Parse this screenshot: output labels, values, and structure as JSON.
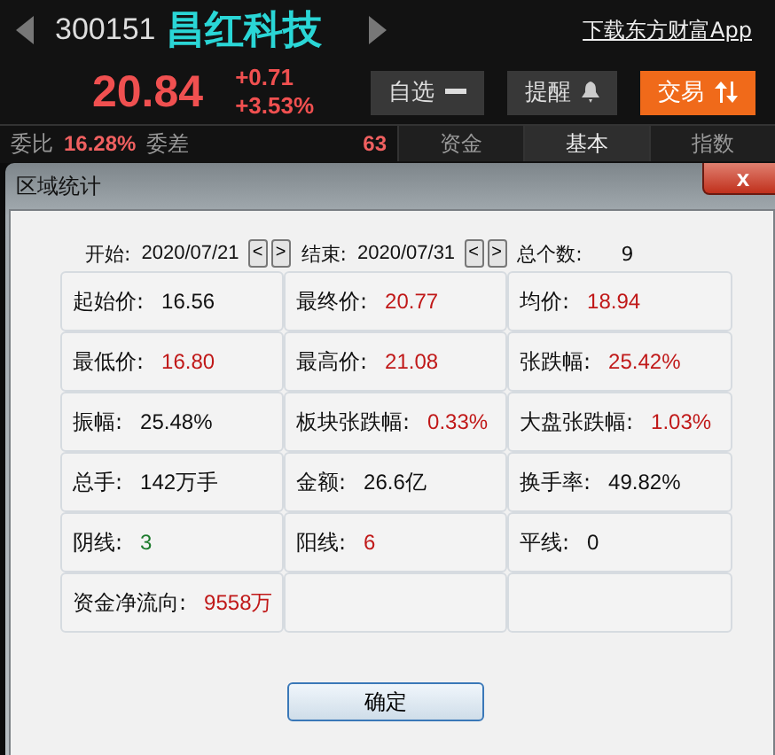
{
  "quote": {
    "code": "300151",
    "name": "昌红科技",
    "price": "20.84",
    "change": "+0.71",
    "change_pct": "+3.53%",
    "download_link": "下载东方财富App"
  },
  "actions": [
    {
      "label": "自选",
      "kind": "minus"
    },
    {
      "label": "提醒",
      "kind": "bell"
    },
    {
      "label": "交易",
      "kind": "trade"
    }
  ],
  "bid_ratio": {
    "label": "委比",
    "value": "16.28%",
    "diff_label": "委差",
    "diff_value": "63"
  },
  "tabs": [
    {
      "label": "资金",
      "selected": false
    },
    {
      "label": "基本",
      "selected": true
    },
    {
      "label": "指数",
      "selected": false
    }
  ],
  "dialog": {
    "title": "区域统计",
    "close": "x",
    "start_label": "开始:",
    "start_date": "2020/07/21",
    "end_label": "结束:",
    "end_date": "2020/07/31",
    "prev": "<",
    "next": ">",
    "count_label": "总个数:",
    "count": "9",
    "rows": [
      [
        {
          "label": "起始价:",
          "value": "16.56",
          "color": "#111111"
        },
        {
          "label": "最终价:",
          "value": "20.77",
          "color": "#c01818"
        },
        {
          "label": "均价:",
          "value": "18.94",
          "color": "#c01818"
        }
      ],
      [
        {
          "label": "最低价:",
          "value": "16.80",
          "color": "#c01818"
        },
        {
          "label": "最高价:",
          "value": "21.08",
          "color": "#c01818"
        },
        {
          "label": "张跌幅:",
          "value": "25.42%",
          "color": "#c01818"
        }
      ],
      [
        {
          "label": "振幅:",
          "value": "25.48%",
          "color": "#111111"
        },
        {
          "label": "板块张跌幅:",
          "value": "0.33%",
          "color": "#c01818"
        },
        {
          "label": "大盘张跌幅:",
          "value": "1.03%",
          "color": "#c01818"
        }
      ],
      [
        {
          "label": "总手:",
          "value": "142万手",
          "color": "#111111"
        },
        {
          "label": "金额:",
          "value": "26.6亿",
          "color": "#111111"
        },
        {
          "label": "换手率:",
          "value": "49.82%",
          "color": "#111111"
        }
      ],
      [
        {
          "label": "阴线:",
          "value": "3",
          "color": "#1c7a2c"
        },
        {
          "label": "阳线:",
          "value": "6",
          "color": "#c01818"
        },
        {
          "label": "平线:",
          "value": "0",
          "color": "#111111"
        }
      ],
      [
        {
          "label": "资金净流向:",
          "value": "9558万",
          "color": "#c01818"
        }
      ]
    ],
    "ok": "确定"
  }
}
